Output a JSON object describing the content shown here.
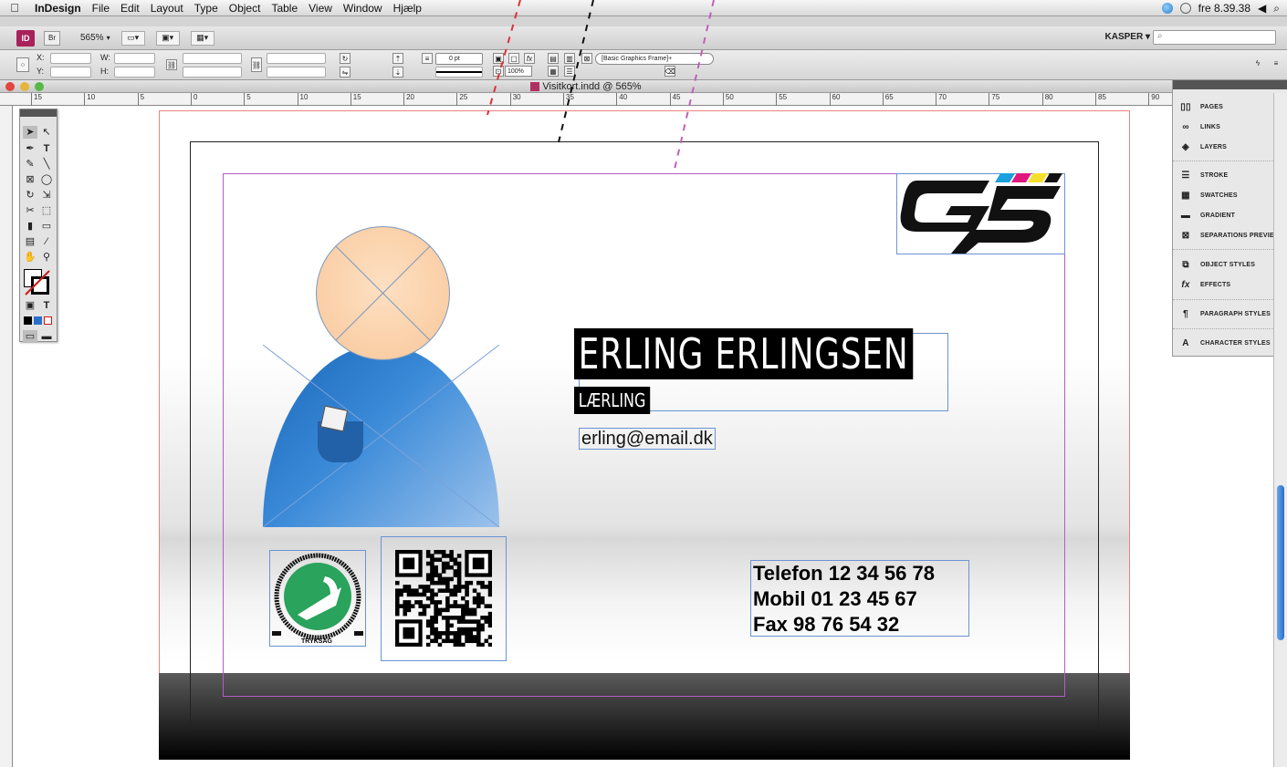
{
  "menubar": {
    "app": "InDesign",
    "items": [
      "File",
      "Edit",
      "Layout",
      "Type",
      "Object",
      "Table",
      "View",
      "Window",
      "Hjælp"
    ],
    "clock": "fre 8.39.38"
  },
  "appbar": {
    "id_logo": "ID",
    "br_logo": "Br",
    "zoom": "565%",
    "user": "KASPER ▾"
  },
  "control": {
    "x_label": "X:",
    "y_label": "Y:",
    "w_label": "W:",
    "h_label": "H:",
    "stroke_weight": "0 pt",
    "opacity": "100%",
    "object_style": "[Basic Graphics Frame]+"
  },
  "document": {
    "title": "Visitkort.indd @ 565%"
  },
  "ruler": {
    "ticks": [
      "15",
      "10",
      "5",
      "0",
      "5",
      "10",
      "15",
      "20",
      "25",
      "30",
      "35",
      "40",
      "45",
      "50",
      "55",
      "60",
      "65",
      "70",
      "75",
      "80",
      "85",
      "90"
    ]
  },
  "card": {
    "name": "ERLING ERLINGSEN",
    "role": "LÆRLING",
    "email": "erling@email.dk",
    "phone": "Telefon 12 34 56 78",
    "mobile": "Mobil 01 23 45 67",
    "fax": "Fax 98 76 54 32",
    "swan_text_bottom": "TRYKSAG"
  },
  "panels": {
    "items": [
      "PAGES",
      "LINKS",
      "LAYERS",
      "STROKE",
      "SWATCHES",
      "GRADIENT",
      "SEPARATIONS PREVIEW",
      "OBJECT STYLES",
      "EFFECTS",
      "PARAGRAPH STYLES",
      "CHARACTER STYLES"
    ]
  }
}
